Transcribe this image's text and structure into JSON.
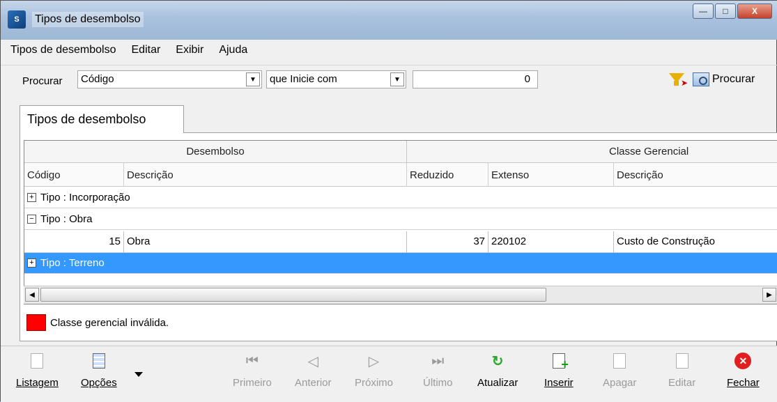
{
  "window": {
    "title": "Tipos de desembolso",
    "app_icon": "app-logo-icon",
    "controls": {
      "minimize": "—",
      "maximize": "□",
      "close": "X"
    }
  },
  "menu": {
    "items": [
      {
        "label": "Tipos de desembolso"
      },
      {
        "label": "Editar"
      },
      {
        "label": "Exibir"
      },
      {
        "label": "Ajuda"
      }
    ]
  },
  "search": {
    "label": "Procurar",
    "field": "Código",
    "operator": "que Inicie com",
    "value": "0",
    "search_button": "Procurar"
  },
  "tabs": {
    "active": "Tipos de desembolso"
  },
  "grid": {
    "band_left": "Desembolso",
    "band_right": "Classe Gerencial",
    "columns": {
      "codigo": "Código",
      "descricao": "Descrição",
      "reduzido": "Reduzido",
      "extenso": "Extenso",
      "descricao2": "Descrição"
    },
    "groups": [
      {
        "label": "Tipo : Incorporação",
        "expander": "+"
      },
      {
        "label": "Tipo : Obra",
        "expander": "−"
      },
      {
        "label": "Tipo : Terreno",
        "expander": "+"
      }
    ],
    "row": {
      "codigo": "15",
      "descricao": "Obra",
      "reduzido": "37",
      "extenso": "220102",
      "descricao2": "Custo de Construção"
    }
  },
  "legend": {
    "text": "Classe gerencial inválida.",
    "color": "#ff0000"
  },
  "toolbar": {
    "listagem": "Listagem",
    "opcoes": "Opções",
    "primeiro": "Primeiro",
    "anterior": "Anterior",
    "proximo": "Próximo",
    "ultimo": "Último",
    "atualizar": "Atualizar",
    "inserir": "Inserir",
    "apagar": "Apagar",
    "editar": "Editar",
    "fechar": "Fechar"
  }
}
